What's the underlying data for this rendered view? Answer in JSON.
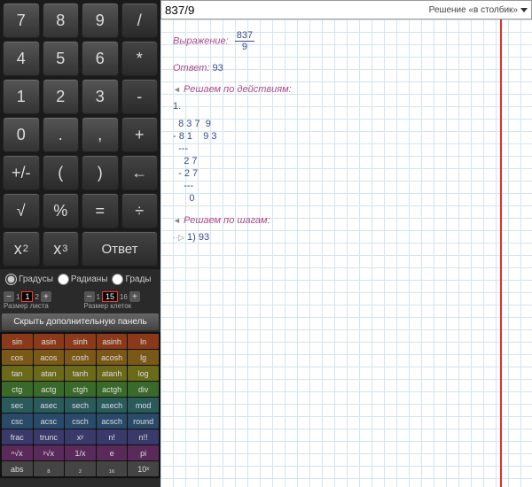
{
  "input_expression": "837/9",
  "mode_label": "Решение «в столбик»",
  "keypad": {
    "r1": [
      "7",
      "8",
      "9",
      "/"
    ],
    "r2": [
      "4",
      "5",
      "6",
      "*"
    ],
    "r3": [
      "1",
      "2",
      "3",
      "-"
    ],
    "r4": [
      "0",
      ".",
      ",",
      "+"
    ],
    "r5": [
      "+/-",
      "(",
      ")",
      "←"
    ],
    "r6": [
      "√",
      "%",
      "=",
      "÷"
    ]
  },
  "x2": "x",
  "x2s": "2",
  "x3": "x",
  "x3s": "3",
  "answer_btn": "Ответ",
  "angle": {
    "deg": "Градусы",
    "rad": "Радианы",
    "grad": "Грады"
  },
  "size": {
    "sheet_lbl": "Размер листа",
    "sheet_min": "1",
    "sheet_val": "1",
    "sheet_max": "2",
    "cell_lbl": "Размер клеток",
    "cell_min": "1",
    "cell_val": "15",
    "cell_max": "16"
  },
  "hide_panel": "Скрыть дополнительную панель",
  "fns": [
    [
      "sin",
      "asin",
      "sinh",
      "asinh",
      "ln"
    ],
    [
      "cos",
      "acos",
      "cosh",
      "acosh",
      "lg"
    ],
    [
      "tan",
      "atan",
      "tanh",
      "atanh",
      "log"
    ],
    [
      "ctg",
      "actg",
      "ctgh",
      "actgh",
      "div"
    ],
    [
      "sec",
      "asec",
      "sech",
      "asech",
      "mod"
    ],
    [
      "csc",
      "acsc",
      "csch",
      "acsch",
      "round"
    ],
    [
      "frac",
      "trunc",
      "xʸ",
      "n!",
      "n!!"
    ],
    [
      "ⁿ√x",
      "ʸ√x",
      "1/x",
      "e",
      "pi"
    ],
    [
      "abs",
      "₈",
      "₂",
      "₁₆",
      "10ˣ"
    ]
  ],
  "solution": {
    "expr_lbl": "Выражение:",
    "expr_num": "837",
    "expr_den": "9",
    "ans_lbl": "Ответ:",
    "ans": "93",
    "sec1": "Решаем по действиям:",
    "step1": "1.",
    "work": "  8 3 7  9\n- 8 1    9 3\n  ---\n    2 7\n  - 2 7\n    ---\n      0",
    "sec2": "Решаем по шагам:",
    "step2": "1) 93"
  }
}
